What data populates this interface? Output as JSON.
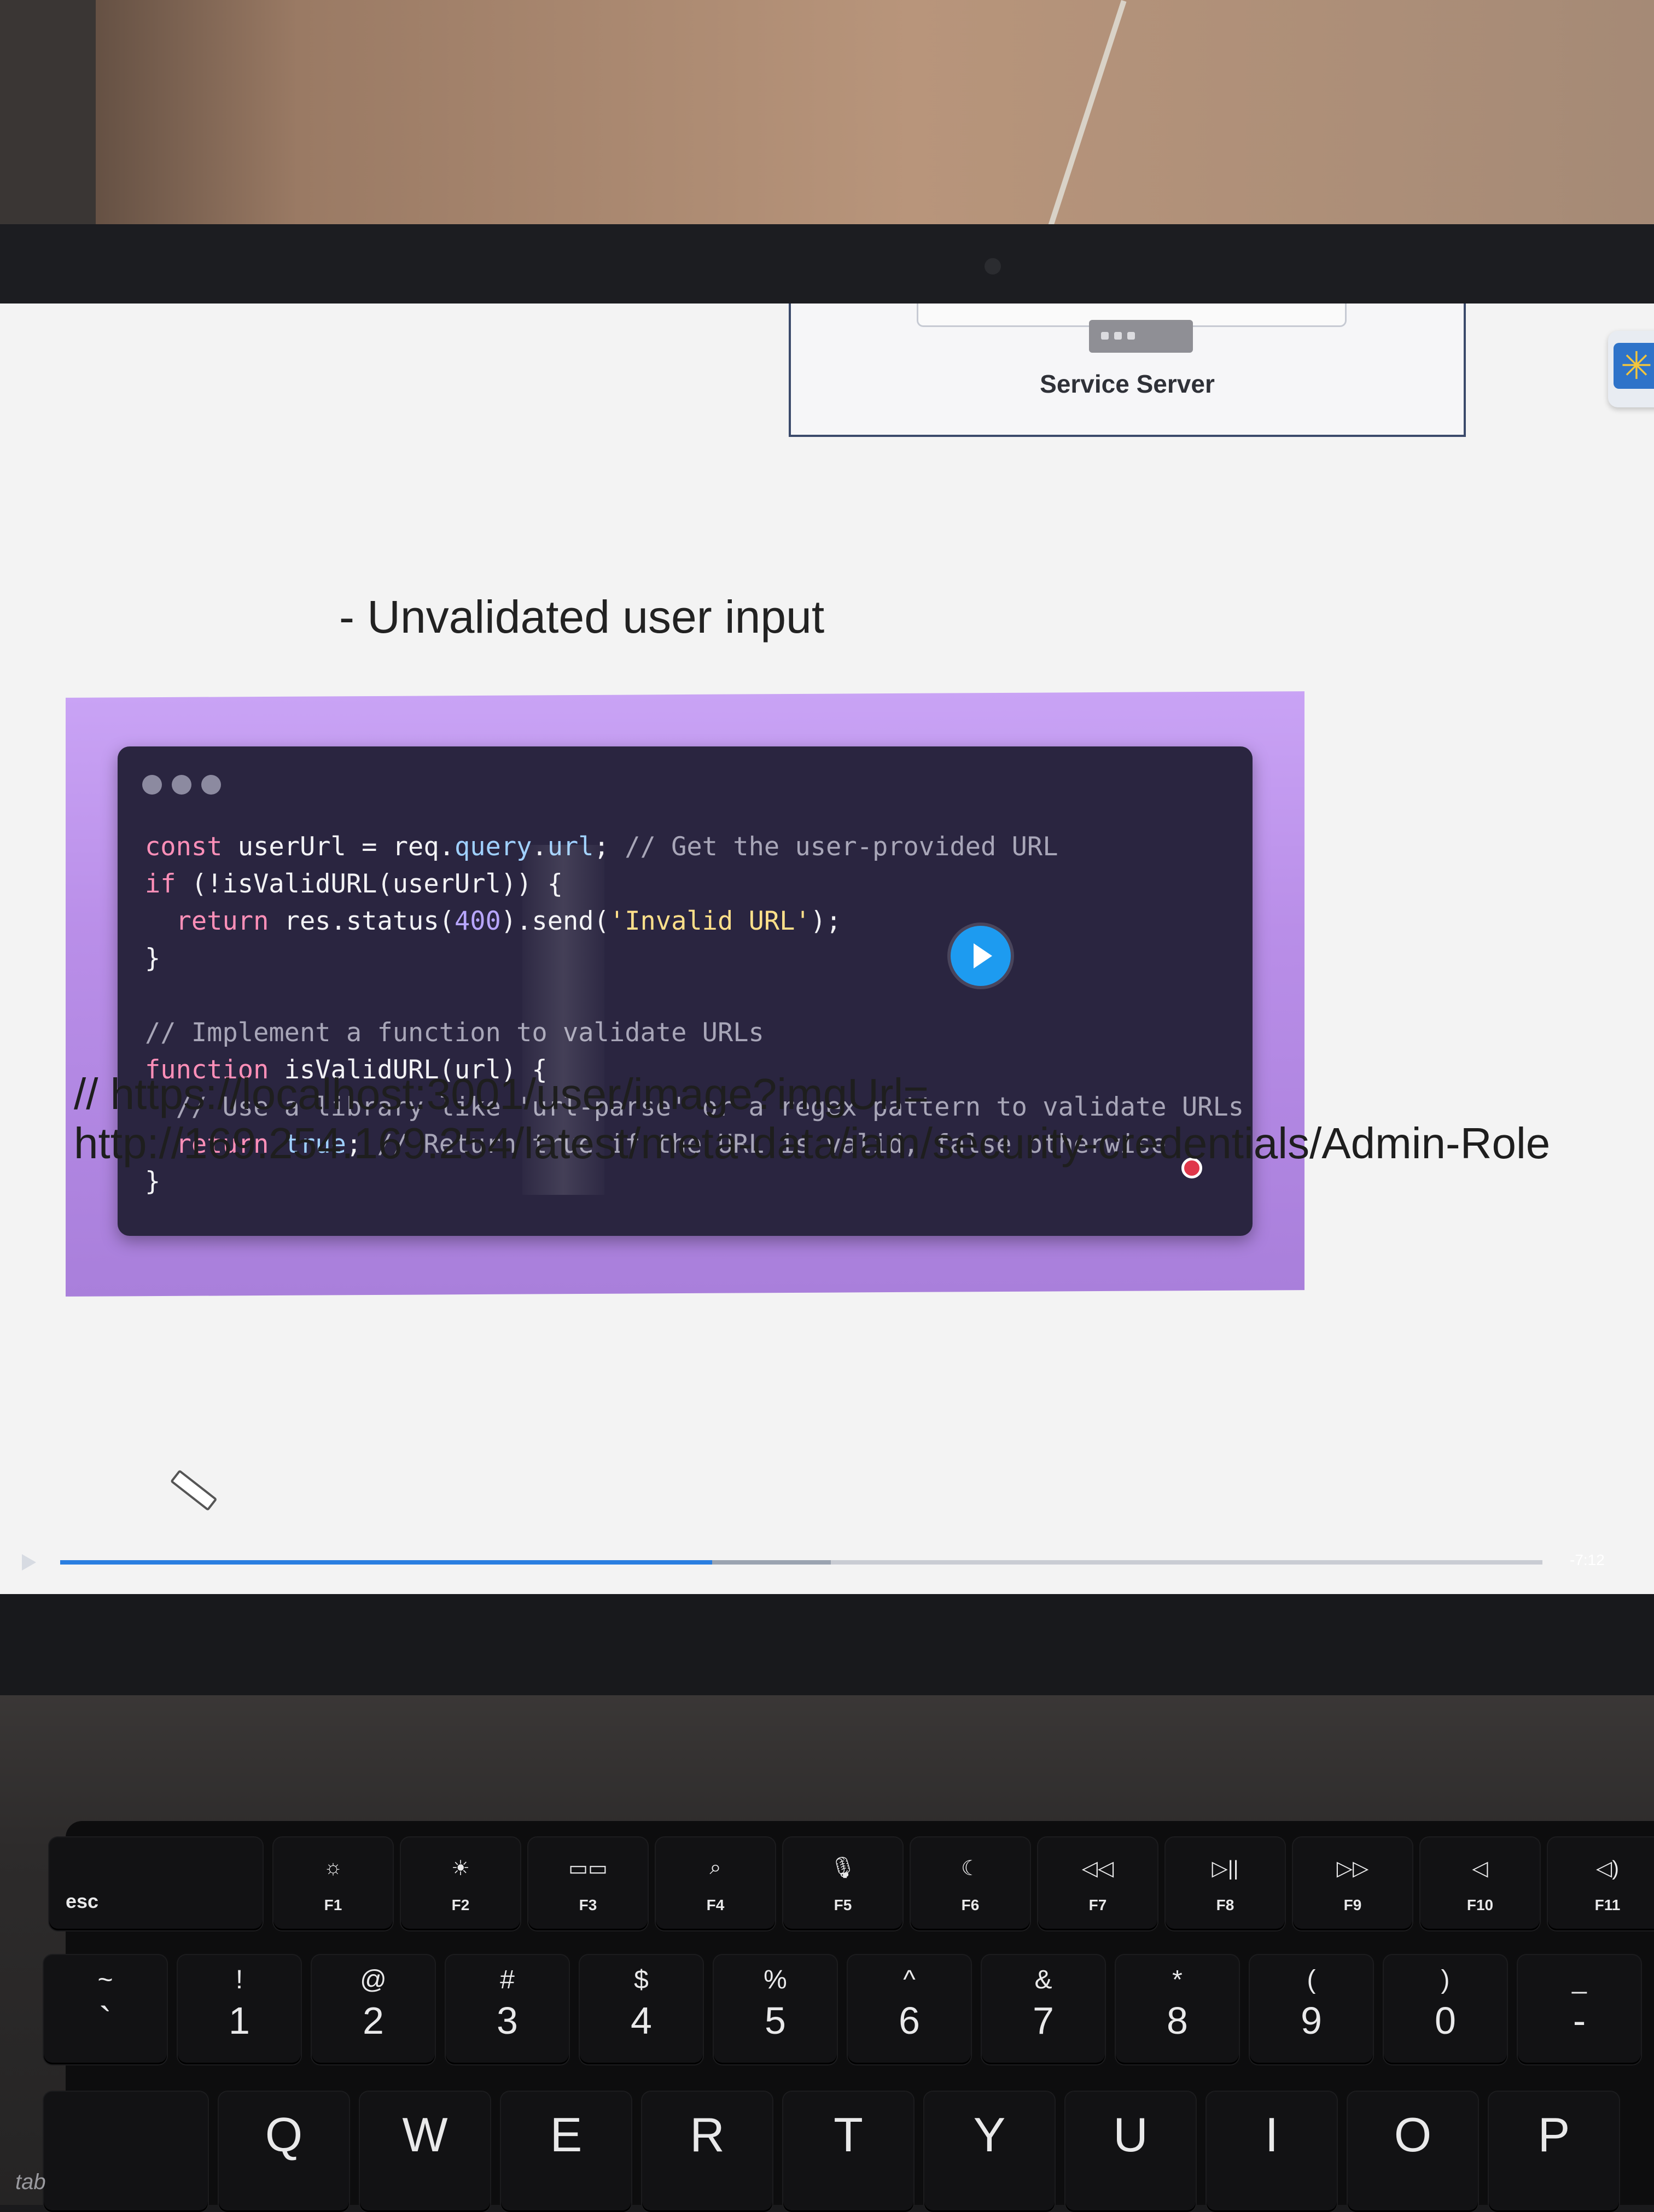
{
  "slide": {
    "server_label": "Service Server",
    "heading": "- Unvalidated user input",
    "code_lines": [
      [
        [
          "kw",
          "const "
        ],
        [
          "",
          "userUrl = req."
        ],
        [
          "prop",
          "query"
        ],
        [
          "",
          "."
        ],
        [
          "prop",
          "url"
        ],
        [
          "",
          "; "
        ],
        [
          "cm",
          "// Get the user-provided URL"
        ]
      ],
      [
        [
          "kw",
          "if "
        ],
        [
          "",
          "(!isValidURL(userUrl)) {"
        ]
      ],
      [
        [
          "",
          "  "
        ],
        [
          "kw",
          "return "
        ],
        [
          "",
          "res.status("
        ],
        [
          "num",
          "400"
        ],
        [
          "",
          ").send("
        ],
        [
          "str",
          "'Invalid URL'"
        ],
        [
          "",
          ");"
        ]
      ],
      [
        [
          "",
          "}"
        ]
      ],
      [
        [
          "",
          ""
        ]
      ],
      [
        [
          "cm",
          "// Implement a function to validate URLs"
        ]
      ],
      [
        [
          "kw",
          "function "
        ],
        [
          "",
          "isValidURL(url) {"
        ]
      ],
      [
        [
          "",
          "  "
        ],
        [
          "cm",
          "// Use a library like 'url-parse' or a regex pattern to validate URLs"
        ]
      ],
      [
        [
          "",
          "  "
        ],
        [
          "kw",
          "return "
        ],
        [
          "prop",
          "true"
        ],
        [
          "",
          "; "
        ],
        [
          "cm",
          "// Return true if the URL is valid, false otherwise"
        ]
      ],
      [
        [
          "",
          "}"
        ]
      ]
    ],
    "url_line_1": "// https://localhost:3001/user/image?imgUrl=",
    "url_line_2": "http://169.254.169.254/latest/meta-data/iam/security-credentials/Admin-Role"
  },
  "player": {
    "progress": 0.44,
    "buffered": 0.52,
    "time": "-7:12"
  },
  "keyboard": {
    "esc": "esc",
    "fn_keys": [
      {
        "label": "F1",
        "icon": "☼"
      },
      {
        "label": "F2",
        "icon": "☀"
      },
      {
        "label": "F3",
        "icon": "▭▭"
      },
      {
        "label": "F4",
        "icon": "⌕"
      },
      {
        "label": "F5",
        "icon": "🎙"
      },
      {
        "label": "F6",
        "icon": "☾"
      },
      {
        "label": "F7",
        "icon": "◁◁"
      },
      {
        "label": "F8",
        "icon": "▷||"
      },
      {
        "label": "F9",
        "icon": "▷▷"
      },
      {
        "label": "F10",
        "icon": "◁"
      },
      {
        "label": "F11",
        "icon": "◁)"
      }
    ],
    "number_keys": [
      {
        "sym": "~",
        "num": "`"
      },
      {
        "sym": "!",
        "num": "1"
      },
      {
        "sym": "@",
        "num": "2"
      },
      {
        "sym": "#",
        "num": "3"
      },
      {
        "sym": "$",
        "num": "4"
      },
      {
        "sym": "%",
        "num": "5"
      },
      {
        "sym": "^",
        "num": "6"
      },
      {
        "sym": "&",
        "num": "7"
      },
      {
        "sym": "*",
        "num": "8"
      },
      {
        "sym": "(",
        "num": "9"
      },
      {
        "sym": ")",
        "num": "0"
      },
      {
        "sym": "_",
        "num": "-"
      }
    ],
    "letter_keys": [
      "Q",
      "W",
      "E",
      "R",
      "T",
      "Y",
      "U",
      "I",
      "O",
      "P"
    ],
    "tab": "tab"
  }
}
